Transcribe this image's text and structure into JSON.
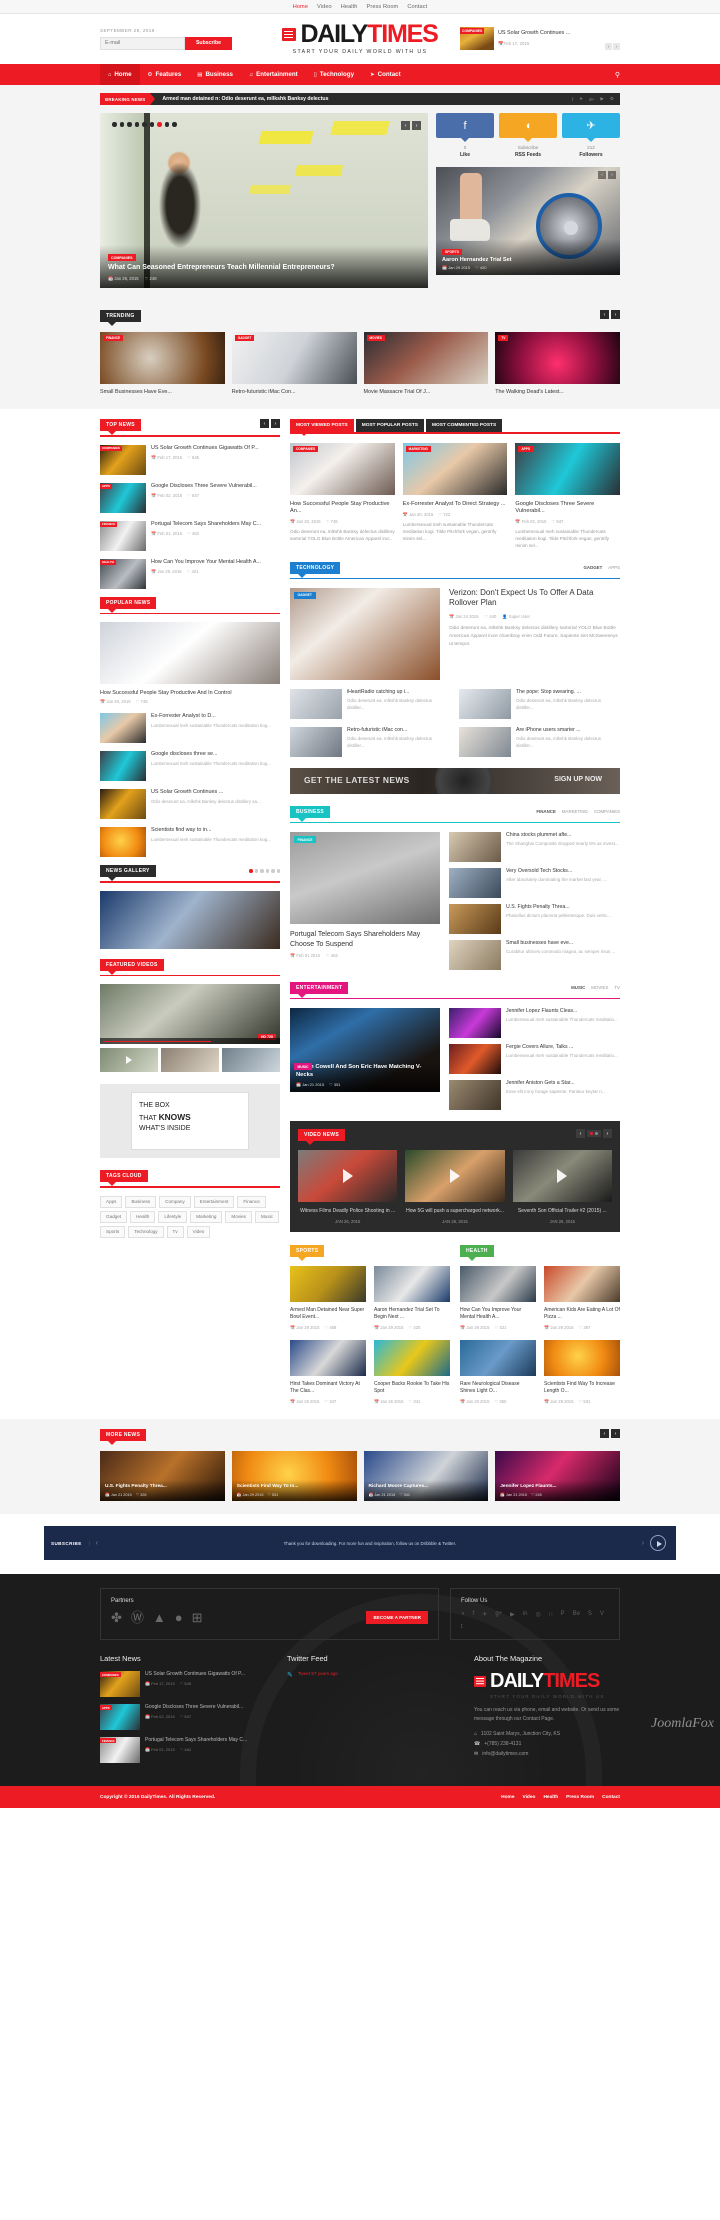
{
  "topbar": {
    "links": [
      "Home",
      "Video",
      "Health",
      "Press Room",
      "Contact"
    ],
    "active": "Home"
  },
  "header": {
    "date": "SEPTEMBER 28, 2016",
    "email_placeholder": "E-mail",
    "subscribe_label": "Subscribe",
    "logo": {
      "daily": "DAILY",
      "times": "TIMES",
      "tagline": "START YOUR DAILY WORLD WITH US"
    },
    "ticker": {
      "category": "COMPANIES",
      "title": "US Solar Growth Continues ...",
      "date": "Feb 17, 2015",
      "prev": "‹",
      "next": "›"
    }
  },
  "nav": {
    "items": [
      {
        "label": "Home",
        "icon": "⌂"
      },
      {
        "label": "Features",
        "icon": "⚙"
      },
      {
        "label": "Business",
        "icon": "▤"
      },
      {
        "label": "Entertainment",
        "icon": "♫"
      },
      {
        "label": "Technology",
        "icon": "▯"
      },
      {
        "label": "Contact",
        "icon": "➤"
      }
    ],
    "active": "Home",
    "search_icon": "⚲"
  },
  "breaking": {
    "tag": "BREAKING NEWS",
    "text": "Armed man detained n: Odio deserunt ea, mllkshk Banksy delectus",
    "socials": [
      "f",
      "➤",
      "8+",
      "▶",
      "⚙"
    ]
  },
  "hero": {
    "main": {
      "category": "COMPANIES",
      "title": "What Can Seasoned Entrepreneurs Teach Millennial Entrepreneurs?",
      "date": "Jan 29, 2015",
      "likes": "248",
      "dots": 9,
      "active_dot": 6,
      "prev": "‹",
      "next": "›"
    },
    "social": [
      {
        "name": "facebook",
        "glyph": "f",
        "count": "0",
        "label": "Like",
        "color": "#4a6ea9"
      },
      {
        "name": "rss",
        "glyph": "◖",
        "count": "Subscribe",
        "label": "RSS Feeds",
        "color": "#f5a623"
      },
      {
        "name": "twitter",
        "glyph": "✈",
        "count": "212",
        "label": "Followers",
        "color": "#2cb3e4"
      }
    ],
    "side": {
      "category": "SPORTS",
      "title": "Aaron Hernandez Trial Set",
      "date": "Jan 29 2015",
      "likes": "420",
      "prev": "‹",
      "next": "›"
    }
  },
  "trending": {
    "badge": "TRENDING",
    "prev": "‹",
    "next": "›",
    "items": [
      {
        "category": "FINANCE",
        "title": "Small Businesses Have Eve...",
        "img": "im-chess"
      },
      {
        "category": "GADGET",
        "title": "Retro-futuristic iMac Con...",
        "img": "im-imac"
      },
      {
        "category": "MOVIES",
        "title": "Movie Massacre Trial Of J...",
        "img": "im-movie"
      },
      {
        "category": "TV",
        "title": "The Walking Dead's Latest...",
        "img": "im-tv"
      }
    ]
  },
  "sidebar": {
    "top_news": {
      "badge": "TOP NEWS",
      "prev": "‹",
      "next": "›",
      "items": [
        {
          "category": "COMPANIES",
          "title": "US Solar Growth Continues Gigawatts Of P...",
          "date": "Feb 17, 2015",
          "likes": "545",
          "img": "im-solar"
        },
        {
          "category": "APPS",
          "title": "Google Discloses Three Severe Vulnerabil...",
          "date": "Feb 02, 2015",
          "likes": "547",
          "img": "im-apps"
        },
        {
          "category": "FINANCE",
          "title": "Portugal Telecom Says Shareholders May C...",
          "date": "Feb 01, 2015",
          "likes": "462",
          "img": "im-car"
        },
        {
          "category": "HEALTH",
          "title": "How Can You Improve Your Mental Health A...",
          "date": "Jan 29, 2015",
          "likes": "421",
          "img": "im-health"
        }
      ]
    },
    "popular_news": {
      "badge": "POPULAR NEWS",
      "main": {
        "title": "How Successful People Stay Productive And In Control",
        "date": "Jan 20, 2015",
        "likes": "748"
      },
      "items": [
        {
          "title": "Ex-Forrester Analyst to D...",
          "desc": "Lumbersexual meh sustainable Thundercats meditation kog...",
          "img": "im-camera"
        },
        {
          "title": "Google discloses three se...",
          "desc": "Lumbersexual meh sustainable Thundercats meditation kog...",
          "img": "im-apps"
        },
        {
          "title": "US Solar Growth Continues ...",
          "desc": "Odio deserunt ea, mlkshk Banksy delectus distillery sa...",
          "img": "im-solar"
        },
        {
          "title": "Scientists find way to in...",
          "desc": "Lumbersexual meh sustainable Thundercats meditation kog...",
          "img": "im-orange"
        }
      ]
    },
    "news_gallery": {
      "badge": "NEWS GALLERY",
      "dots": 6,
      "active_dot": 0
    },
    "featured_videos": {
      "badge": "FEATURED VIDEOS",
      "hd_label": "HD 720"
    },
    "ad": {
      "line1": "THE BOX",
      "line2a": "THAT ",
      "line2b": "KNOWS",
      "line3": "WHAT'S INSIDE"
    },
    "tag_cloud": {
      "badge": "TAGS CLOUD",
      "tags": [
        "Apps",
        "Business",
        "Company",
        "Entertainment",
        "Finance",
        "Gadget",
        "Health",
        "Lifestyle",
        "Marketing",
        "Movies",
        "Music",
        "Sports",
        "Technology",
        "Tv",
        "Video"
      ]
    }
  },
  "main": {
    "post_tabs": {
      "tabs": [
        "MOST VIEWED POSTS",
        "MOST POPULAR POSTS",
        "MOST COMMENTED POSTS"
      ],
      "active": "MOST VIEWED POSTS",
      "items": [
        {
          "category": "COMPANIES",
          "title": "How Successful People Stay Productive An...",
          "date": "Jan 20, 2015",
          "likes": "748",
          "desc": "Odio deserunt ea, mlkshk Banksy delectus distillery sartorial YOLO Blue Bottle American Apparel irur...",
          "img": "im-phone"
        },
        {
          "category": "MARKETING",
          "title": "Ex-Forrester Analyst To Direct Strategy ...",
          "date": "Jan 20, 2015",
          "likes": "722",
          "desc": "Lumbersexual meh sustainable Thundercats meditation kogi. Tilde Pitchfork vegan, gentrify minim sel...",
          "img": "im-camera"
        },
        {
          "category": "APPS",
          "title": "Google Discloses Three Severe Vulnerabil...",
          "date": "Feb 02, 2015",
          "likes": "547",
          "desc": "Lumbersexual meh sustainable Thundercats meditation kogi. Tilde Pitchfork vegan, gentrify minim sel...",
          "img": "im-apps"
        }
      ]
    },
    "technology": {
      "badge": "TECHNOLOGY",
      "subs": [
        "GADGET",
        "APPS"
      ],
      "sub_active": "GADGET",
      "featured": {
        "category": "GADGET",
        "title": "Verizon: Don't Expect Us To Offer A Data Rollover Plan",
        "date": "Jan 24 2015",
        "likes": "440",
        "author": "Super User",
        "desc": "Odio deserunt ea, mlkshk Banksy delectus distillery sartorial YOLO Blue Bottle American Apparel irure chambray enim Odd Future. Sapiente sint McSweeneys ut tempor.",
        "img": "im-verizon"
      },
      "small": [
        {
          "title": "iHeartRadio catching up i...",
          "desc": "Odio deserunt ea, mlkshk Banksy delectus distiller...",
          "img": "im-lap1"
        },
        {
          "title": "The pope:  Stop swearing. ...",
          "desc": "Odio deserunt ea, mlkshk Banksy delectus distiller...",
          "img": "im-lap2"
        },
        {
          "title": "Retro-futuristic iMac con...",
          "desc": "Odio deserunt ea, mlkshk Banksy delectus distiller...",
          "img": "im-lap3"
        },
        {
          "title": "Are iPhone users smarter ...",
          "desc": "Odio deserunt ea, mlkshk Banksy delectus distiller...",
          "img": "im-lap4"
        }
      ]
    },
    "banner": {
      "left": "GET THE LATEST NEWS",
      "right": "SIGN UP NOW"
    },
    "business": {
      "badge": "BUSINESS",
      "subs": [
        "FINANCE",
        "MARKETING",
        "COMPANIES"
      ],
      "sub_active": "FINANCE",
      "featured": {
        "category": "FINANCE",
        "title": "Portugal Telecom Says Shareholders May Choose To Suspend",
        "date": "Feb 01 2015",
        "likes": "462",
        "img": "im-corvette"
      },
      "items": [
        {
          "title": "China stocks plummet afte...",
          "desc": "The Shanghai Composite dropped nearly 8% as invest...",
          "img": "im-b1"
        },
        {
          "title": "Very Oversold Tech Stocks...",
          "desc": "After absolutely dominating the market last year, ...",
          "img": "im-b2"
        },
        {
          "title": "U.S. Fights Penalty Threa...",
          "desc": "Phasellus dictum placerat pellentesque. Duis vehic...",
          "img": "im-b3"
        },
        {
          "title": "Small businesses have eve...",
          "desc": "Curabitur ultrices commodo magna, ac semper risus ...",
          "img": "im-b4"
        }
      ]
    },
    "entertainment": {
      "badge": "ENTERTAINMENT",
      "subs": [
        "MUSIC",
        "MOVIES",
        "TV"
      ],
      "sub_active": "MUSIC",
      "featured": {
        "category": "MUSIC",
        "title": "Simon Cowell And Son Eric Have Matching V-Necks",
        "date": "Jan 21 2015",
        "likes": "351",
        "img": "im-simon"
      },
      "items": [
        {
          "title": "Jennifer Lopez Flaunts Cleav...",
          "desc": "Lumbersexual meh sustainable Thundercats meditatio...",
          "img": "im-e1"
        },
        {
          "title": "Fergie Covers Allure, Talks ...",
          "desc": "Lumbersexual meh sustainable Thundercats meditatio...",
          "img": "im-e2"
        },
        {
          "title": "Jennifer Aniston Gets a Star...",
          "desc": "Esse elit irony forage sapiente. Pariatur keytar n...",
          "img": "im-e3"
        }
      ]
    },
    "video_news": {
      "badge": "VIDEO NEWS",
      "prev": "‹",
      "next": "›",
      "dots": 2,
      "active_dot": 0,
      "items": [
        {
          "title": "Witness Films Deadly Police Shooting in ...",
          "date": "JAN 26, 2015",
          "img": "im-v1"
        },
        {
          "title": "How 5G will push a supercharged network...",
          "date": "JAN 26, 2015",
          "img": "im-v2"
        },
        {
          "title": "Seventh Son Official Trailer #2 (2015) ...",
          "date": "JAN 26, 2015",
          "img": "im-v3"
        }
      ]
    },
    "sports": {
      "badge": "SPORTS",
      "items": [
        {
          "title": "Armed Man Detained Near Super Bowl Event...",
          "date": "Jan 29 2015",
          "likes": "469",
          "img": "im-s1"
        },
        {
          "title": "Aaron Hernandez Trial Set To Begin Next ...",
          "date": "Jan 29 2015",
          "likes": "420",
          "img": "im-s2"
        },
        {
          "title": "Hirst Takes Dominant Victory At The Clas...",
          "date": "Jan 26 2015",
          "likes": "347",
          "img": "im-s5"
        },
        {
          "title": "Cooper Backs Rookie To Take His Spot",
          "date": "Jan 26 2015",
          "likes": "341",
          "img": "im-s6"
        }
      ]
    },
    "health": {
      "badge": "HEALTH",
      "items": [
        {
          "title": "How Can You Improve Your Mental Health A...",
          "date": "Jan 29 2015",
          "likes": "421",
          "img": "im-s3"
        },
        {
          "title": "American Kids Are Eating A Lot Of Pizza ...",
          "date": "Jan 29 2015",
          "likes": "367",
          "img": "im-s4"
        },
        {
          "title": "Rare Neurological Disease Shines Light O...",
          "date": "Jan 29 2015",
          "likes": "350",
          "img": "im-s7"
        },
        {
          "title": "Scientists Find Way To Increase Length O...",
          "date": "Jan 29 2015",
          "likes": "531",
          "img": "im-s8"
        }
      ]
    }
  },
  "more_news": {
    "badge": "MORE NEWS",
    "prev": "‹",
    "next": "›",
    "items": [
      {
        "title": "U.S. Fights Penalty Threa...",
        "date": "Jan 21 2015",
        "likes": "326",
        "img": "im-m1"
      },
      {
        "title": "Scientists Find Way To In...",
        "date": "Jan 29 2015",
        "likes": "531",
        "img": "im-m2"
      },
      {
        "title": "Richard Moore Captures...",
        "date": "Jan 21 2015",
        "likes": "341",
        "img": "im-m3"
      },
      {
        "title": "Jennifer Lopez Flaunts...",
        "date": "Jan 21 2015",
        "likes": "245",
        "img": "im-m4"
      }
    ]
  },
  "subscribe_strip": {
    "label": "SUBSCRIBE",
    "prev": "‹",
    "next": "›",
    "text": "Thank you for downloading. For more fun and inspiration, follow us on Dribbble & Twitter."
  },
  "footer": {
    "partners": {
      "title": "Partners",
      "icons": [
        "joomla-icon",
        "wordpress-icon",
        "android-icon",
        "apple-icon",
        "windows-icon"
      ],
      "button": "BECOME A PARTNER"
    },
    "follow": {
      "title": "Follow Us",
      "icons": [
        "rss-icon",
        "facebook-icon",
        "twitter-icon",
        "google-plus-icon",
        "youtube-icon",
        "linkedin-icon",
        "dribbble-icon",
        "flickr-icon",
        "pinterest-icon",
        "behance-icon",
        "skype-icon",
        "vimeo-icon",
        "tumblr-icon"
      ]
    },
    "latest_news": {
      "title": "Latest News",
      "items": [
        {
          "category": "COMPANIES",
          "title": "US Solar Growth Continues Gigawatts Of P...",
          "date": "Feb 17, 2015",
          "likes": "545",
          "img": "im-solar"
        },
        {
          "category": "APPS",
          "title": "Google Discloses Three Severe Vulnerabil...",
          "date": "Feb 02, 2015",
          "likes": "547",
          "img": "im-apps"
        },
        {
          "category": "FINANCE",
          "title": "Portugal Telecom Says Shareholders May C...",
          "date": "Feb 01, 2015",
          "likes": "462",
          "img": "im-car"
        }
      ]
    },
    "twitter": {
      "title": "Twitter Feed",
      "tweet": "Tweet 57 years ago"
    },
    "about": {
      "title": "About The Magazine",
      "logo": {
        "daily": "DAILY",
        "times": "TIMES",
        "tagline": "START YOUR DAILY WORLD WITH US"
      },
      "desc": "You can reach us via phone, email and website. Or send us some message through our Contact Page.",
      "address": "1102 Saint Marys, Junction City, KS",
      "phone": "+(785) 238-4131",
      "email": "info@dailytimes.com"
    },
    "bottom": {
      "copyright": "Copyright © 2016 DailyTimes. All Rights Reserved.",
      "links": [
        "Home",
        "Video",
        "Health",
        "Press Room",
        "Contact"
      ]
    },
    "watermark": "JoomlaFox"
  }
}
